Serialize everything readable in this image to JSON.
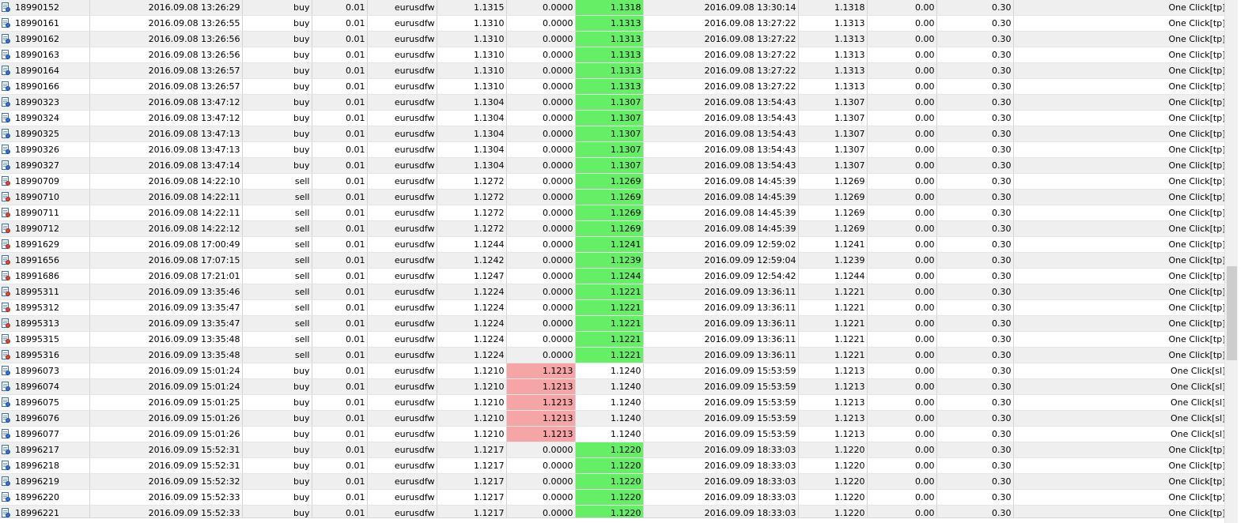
{
  "rows": [
    {
      "ticket": "18990152",
      "open_time": "2016.09.08 13:26:29",
      "type": "buy",
      "size": "0.01",
      "symbol": "eurusdfw",
      "price": "1.1315",
      "sl": "0.0000",
      "tp": "1.1318",
      "close_time": "2016.09.08 13:30:14",
      "close_price": "1.1318",
      "commission": "0.00",
      "profit": "0.30",
      "comment": "One Click[tp]",
      "hl": "tp"
    },
    {
      "ticket": "18990161",
      "open_time": "2016.09.08 13:26:55",
      "type": "buy",
      "size": "0.01",
      "symbol": "eurusdfw",
      "price": "1.1310",
      "sl": "0.0000",
      "tp": "1.1313",
      "close_time": "2016.09.08 13:27:22",
      "close_price": "1.1313",
      "commission": "0.00",
      "profit": "0.30",
      "comment": "One Click[tp]",
      "hl": "tp"
    },
    {
      "ticket": "18990162",
      "open_time": "2016.09.08 13:26:56",
      "type": "buy",
      "size": "0.01",
      "symbol": "eurusdfw",
      "price": "1.1310",
      "sl": "0.0000",
      "tp": "1.1313",
      "close_time": "2016.09.08 13:27:22",
      "close_price": "1.1313",
      "commission": "0.00",
      "profit": "0.30",
      "comment": "One Click[tp]",
      "hl": "tp"
    },
    {
      "ticket": "18990163",
      "open_time": "2016.09.08 13:26:56",
      "type": "buy",
      "size": "0.01",
      "symbol": "eurusdfw",
      "price": "1.1310",
      "sl": "0.0000",
      "tp": "1.1313",
      "close_time": "2016.09.08 13:27:22",
      "close_price": "1.1313",
      "commission": "0.00",
      "profit": "0.30",
      "comment": "One Click[tp]",
      "hl": "tp"
    },
    {
      "ticket": "18990164",
      "open_time": "2016.09.08 13:26:57",
      "type": "buy",
      "size": "0.01",
      "symbol": "eurusdfw",
      "price": "1.1310",
      "sl": "0.0000",
      "tp": "1.1313",
      "close_time": "2016.09.08 13:27:22",
      "close_price": "1.1313",
      "commission": "0.00",
      "profit": "0.30",
      "comment": "One Click[tp]",
      "hl": "tp"
    },
    {
      "ticket": "18990166",
      "open_time": "2016.09.08 13:26:57",
      "type": "buy",
      "size": "0.01",
      "symbol": "eurusdfw",
      "price": "1.1310",
      "sl": "0.0000",
      "tp": "1.1313",
      "close_time": "2016.09.08 13:27:22",
      "close_price": "1.1313",
      "commission": "0.00",
      "profit": "0.30",
      "comment": "One Click[tp]",
      "hl": "tp"
    },
    {
      "ticket": "18990323",
      "open_time": "2016.09.08 13:47:12",
      "type": "buy",
      "size": "0.01",
      "symbol": "eurusdfw",
      "price": "1.1304",
      "sl": "0.0000",
      "tp": "1.1307",
      "close_time": "2016.09.08 13:54:43",
      "close_price": "1.1307",
      "commission": "0.00",
      "profit": "0.30",
      "comment": "One Click[tp]",
      "hl": "tp"
    },
    {
      "ticket": "18990324",
      "open_time": "2016.09.08 13:47:12",
      "type": "buy",
      "size": "0.01",
      "symbol": "eurusdfw",
      "price": "1.1304",
      "sl": "0.0000",
      "tp": "1.1307",
      "close_time": "2016.09.08 13:54:43",
      "close_price": "1.1307",
      "commission": "0.00",
      "profit": "0.30",
      "comment": "One Click[tp]",
      "hl": "tp"
    },
    {
      "ticket": "18990325",
      "open_time": "2016.09.08 13:47:13",
      "type": "buy",
      "size": "0.01",
      "symbol": "eurusdfw",
      "price": "1.1304",
      "sl": "0.0000",
      "tp": "1.1307",
      "close_time": "2016.09.08 13:54:43",
      "close_price": "1.1307",
      "commission": "0.00",
      "profit": "0.30",
      "comment": "One Click[tp]",
      "hl": "tp"
    },
    {
      "ticket": "18990326",
      "open_time": "2016.09.08 13:47:13",
      "type": "buy",
      "size": "0.01",
      "symbol": "eurusdfw",
      "price": "1.1304",
      "sl": "0.0000",
      "tp": "1.1307",
      "close_time": "2016.09.08 13:54:43",
      "close_price": "1.1307",
      "commission": "0.00",
      "profit": "0.30",
      "comment": "One Click[tp]",
      "hl": "tp"
    },
    {
      "ticket": "18990327",
      "open_time": "2016.09.08 13:47:14",
      "type": "buy",
      "size": "0.01",
      "symbol": "eurusdfw",
      "price": "1.1304",
      "sl": "0.0000",
      "tp": "1.1307",
      "close_time": "2016.09.08 13:54:43",
      "close_price": "1.1307",
      "commission": "0.00",
      "profit": "0.30",
      "comment": "One Click[tp]",
      "hl": "tp"
    },
    {
      "ticket": "18990709",
      "open_time": "2016.09.08 14:22:10",
      "type": "sell",
      "size": "0.01",
      "symbol": "eurusdfw",
      "price": "1.1272",
      "sl": "0.0000",
      "tp": "1.1269",
      "close_time": "2016.09.08 14:45:39",
      "close_price": "1.1269",
      "commission": "0.00",
      "profit": "0.30",
      "comment": "One Click[tp]",
      "hl": "tp"
    },
    {
      "ticket": "18990710",
      "open_time": "2016.09.08 14:22:11",
      "type": "sell",
      "size": "0.01",
      "symbol": "eurusdfw",
      "price": "1.1272",
      "sl": "0.0000",
      "tp": "1.1269",
      "close_time": "2016.09.08 14:45:39",
      "close_price": "1.1269",
      "commission": "0.00",
      "profit": "0.30",
      "comment": "One Click[tp]",
      "hl": "tp"
    },
    {
      "ticket": "18990711",
      "open_time": "2016.09.08 14:22:11",
      "type": "sell",
      "size": "0.01",
      "symbol": "eurusdfw",
      "price": "1.1272",
      "sl": "0.0000",
      "tp": "1.1269",
      "close_time": "2016.09.08 14:45:39",
      "close_price": "1.1269",
      "commission": "0.00",
      "profit": "0.30",
      "comment": "One Click[tp]",
      "hl": "tp"
    },
    {
      "ticket": "18990712",
      "open_time": "2016.09.08 14:22:12",
      "type": "sell",
      "size": "0.01",
      "symbol": "eurusdfw",
      "price": "1.1272",
      "sl": "0.0000",
      "tp": "1.1269",
      "close_time": "2016.09.08 14:45:39",
      "close_price": "1.1269",
      "commission": "0.00",
      "profit": "0.30",
      "comment": "One Click[tp]",
      "hl": "tp"
    },
    {
      "ticket": "18991629",
      "open_time": "2016.09.08 17:00:49",
      "type": "sell",
      "size": "0.01",
      "symbol": "eurusdfw",
      "price": "1.1244",
      "sl": "0.0000",
      "tp": "1.1241",
      "close_time": "2016.09.09 12:59:02",
      "close_price": "1.1241",
      "commission": "0.00",
      "profit": "0.30",
      "comment": "One Click[tp]",
      "hl": "tp"
    },
    {
      "ticket": "18991656",
      "open_time": "2016.09.08 17:07:15",
      "type": "sell",
      "size": "0.01",
      "symbol": "eurusdfw",
      "price": "1.1242",
      "sl": "0.0000",
      "tp": "1.1239",
      "close_time": "2016.09.09 12:59:04",
      "close_price": "1.1239",
      "commission": "0.00",
      "profit": "0.30",
      "comment": "One Click[tp]",
      "hl": "tp"
    },
    {
      "ticket": "18991686",
      "open_time": "2016.09.08 17:21:01",
      "type": "sell",
      "size": "0.01",
      "symbol": "eurusdfw",
      "price": "1.1247",
      "sl": "0.0000",
      "tp": "1.1244",
      "close_time": "2016.09.09 12:54:42",
      "close_price": "1.1244",
      "commission": "0.00",
      "profit": "0.30",
      "comment": "One Click[tp]",
      "hl": "tp"
    },
    {
      "ticket": "18995311",
      "open_time": "2016.09.09 13:35:46",
      "type": "sell",
      "size": "0.01",
      "symbol": "eurusdfw",
      "price": "1.1224",
      "sl": "0.0000",
      "tp": "1.1221",
      "close_time": "2016.09.09 13:36:11",
      "close_price": "1.1221",
      "commission": "0.00",
      "profit": "0.30",
      "comment": "One Click[tp]",
      "hl": "tp"
    },
    {
      "ticket": "18995312",
      "open_time": "2016.09.09 13:35:47",
      "type": "sell",
      "size": "0.01",
      "symbol": "eurusdfw",
      "price": "1.1224",
      "sl": "0.0000",
      "tp": "1.1221",
      "close_time": "2016.09.09 13:36:11",
      "close_price": "1.1221",
      "commission": "0.00",
      "profit": "0.30",
      "comment": "One Click[tp]",
      "hl": "tp"
    },
    {
      "ticket": "18995313",
      "open_time": "2016.09.09 13:35:47",
      "type": "sell",
      "size": "0.01",
      "symbol": "eurusdfw",
      "price": "1.1224",
      "sl": "0.0000",
      "tp": "1.1221",
      "close_time": "2016.09.09 13:36:11",
      "close_price": "1.1221",
      "commission": "0.00",
      "profit": "0.30",
      "comment": "One Click[tp]",
      "hl": "tp"
    },
    {
      "ticket": "18995315",
      "open_time": "2016.09.09 13:35:48",
      "type": "sell",
      "size": "0.01",
      "symbol": "eurusdfw",
      "price": "1.1224",
      "sl": "0.0000",
      "tp": "1.1221",
      "close_time": "2016.09.09 13:36:11",
      "close_price": "1.1221",
      "commission": "0.00",
      "profit": "0.30",
      "comment": "One Click[tp]",
      "hl": "tp"
    },
    {
      "ticket": "18995316",
      "open_time": "2016.09.09 13:35:48",
      "type": "sell",
      "size": "0.01",
      "symbol": "eurusdfw",
      "price": "1.1224",
      "sl": "0.0000",
      "tp": "1.1221",
      "close_time": "2016.09.09 13:36:11",
      "close_price": "1.1221",
      "commission": "0.00",
      "profit": "0.30",
      "comment": "One Click[tp]",
      "hl": "tp"
    },
    {
      "ticket": "18996073",
      "open_time": "2016.09.09 15:01:24",
      "type": "buy",
      "size": "0.01",
      "symbol": "eurusdfw",
      "price": "1.1210",
      "sl": "1.1213",
      "tp": "1.1240",
      "close_time": "2016.09.09 15:53:59",
      "close_price": "1.1213",
      "commission": "0.00",
      "profit": "0.30",
      "comment": "One Click[sl]",
      "hl": "sl"
    },
    {
      "ticket": "18996074",
      "open_time": "2016.09.09 15:01:24",
      "type": "buy",
      "size": "0.01",
      "symbol": "eurusdfw",
      "price": "1.1210",
      "sl": "1.1213",
      "tp": "1.1240",
      "close_time": "2016.09.09 15:53:59",
      "close_price": "1.1213",
      "commission": "0.00",
      "profit": "0.30",
      "comment": "One Click[sl]",
      "hl": "sl"
    },
    {
      "ticket": "18996075",
      "open_time": "2016.09.09 15:01:25",
      "type": "buy",
      "size": "0.01",
      "symbol": "eurusdfw",
      "price": "1.1210",
      "sl": "1.1213",
      "tp": "1.1240",
      "close_time": "2016.09.09 15:53:59",
      "close_price": "1.1213",
      "commission": "0.00",
      "profit": "0.30",
      "comment": "One Click[sl]",
      "hl": "sl"
    },
    {
      "ticket": "18996076",
      "open_time": "2016.09.09 15:01:26",
      "type": "buy",
      "size": "0.01",
      "symbol": "eurusdfw",
      "price": "1.1210",
      "sl": "1.1213",
      "tp": "1.1240",
      "close_time": "2016.09.09 15:53:59",
      "close_price": "1.1213",
      "commission": "0.00",
      "profit": "0.30",
      "comment": "One Click[sl]",
      "hl": "sl"
    },
    {
      "ticket": "18996077",
      "open_time": "2016.09.09 15:01:26",
      "type": "buy",
      "size": "0.01",
      "symbol": "eurusdfw",
      "price": "1.1210",
      "sl": "1.1213",
      "tp": "1.1240",
      "close_time": "2016.09.09 15:53:59",
      "close_price": "1.1213",
      "commission": "0.00",
      "profit": "0.30",
      "comment": "One Click[sl]",
      "hl": "sl"
    },
    {
      "ticket": "18996217",
      "open_time": "2016.09.09 15:52:31",
      "type": "buy",
      "size": "0.01",
      "symbol": "eurusdfw",
      "price": "1.1217",
      "sl": "0.0000",
      "tp": "1.1220",
      "close_time": "2016.09.09 18:33:03",
      "close_price": "1.1220",
      "commission": "0.00",
      "profit": "0.30",
      "comment": "One Click[tp]",
      "hl": "tp"
    },
    {
      "ticket": "18996218",
      "open_time": "2016.09.09 15:52:31",
      "type": "buy",
      "size": "0.01",
      "symbol": "eurusdfw",
      "price": "1.1217",
      "sl": "0.0000",
      "tp": "1.1220",
      "close_time": "2016.09.09 18:33:03",
      "close_price": "1.1220",
      "commission": "0.00",
      "profit": "0.30",
      "comment": "One Click[tp]",
      "hl": "tp"
    },
    {
      "ticket": "18996219",
      "open_time": "2016.09.09 15:52:32",
      "type": "buy",
      "size": "0.01",
      "symbol": "eurusdfw",
      "price": "1.1217",
      "sl": "0.0000",
      "tp": "1.1220",
      "close_time": "2016.09.09 18:33:03",
      "close_price": "1.1220",
      "commission": "0.00",
      "profit": "0.30",
      "comment": "One Click[tp]",
      "hl": "tp"
    },
    {
      "ticket": "18996220",
      "open_time": "2016.09.09 15:52:33",
      "type": "buy",
      "size": "0.01",
      "symbol": "eurusdfw",
      "price": "1.1217",
      "sl": "0.0000",
      "tp": "1.1220",
      "close_time": "2016.09.09 18:33:03",
      "close_price": "1.1220",
      "commission": "0.00",
      "profit": "0.30",
      "comment": "One Click[tp]",
      "hl": "tp"
    },
    {
      "ticket": "18996221",
      "open_time": "2016.09.09 15:52:33",
      "type": "buy",
      "size": "0.01",
      "symbol": "eurusdfw",
      "price": "1.1217",
      "sl": "0.0000",
      "tp": "1.1220",
      "close_time": "2016.09.09 18:33:03",
      "close_price": "1.1220",
      "commission": "0.00",
      "profit": "0.30",
      "comment": "One Click[tp]",
      "hl": "tp"
    }
  ],
  "colors": {
    "tp_highlight": "#66ee66",
    "sl_highlight": "#f5a5a5",
    "row_alt": "#efefef",
    "row_base": "#ffffff"
  },
  "icons": {
    "buy": "buy-order-icon",
    "sell": "sell-order-icon"
  },
  "scrollbar": {
    "position_fraction": 0.62,
    "visible_fraction": 0.18
  }
}
